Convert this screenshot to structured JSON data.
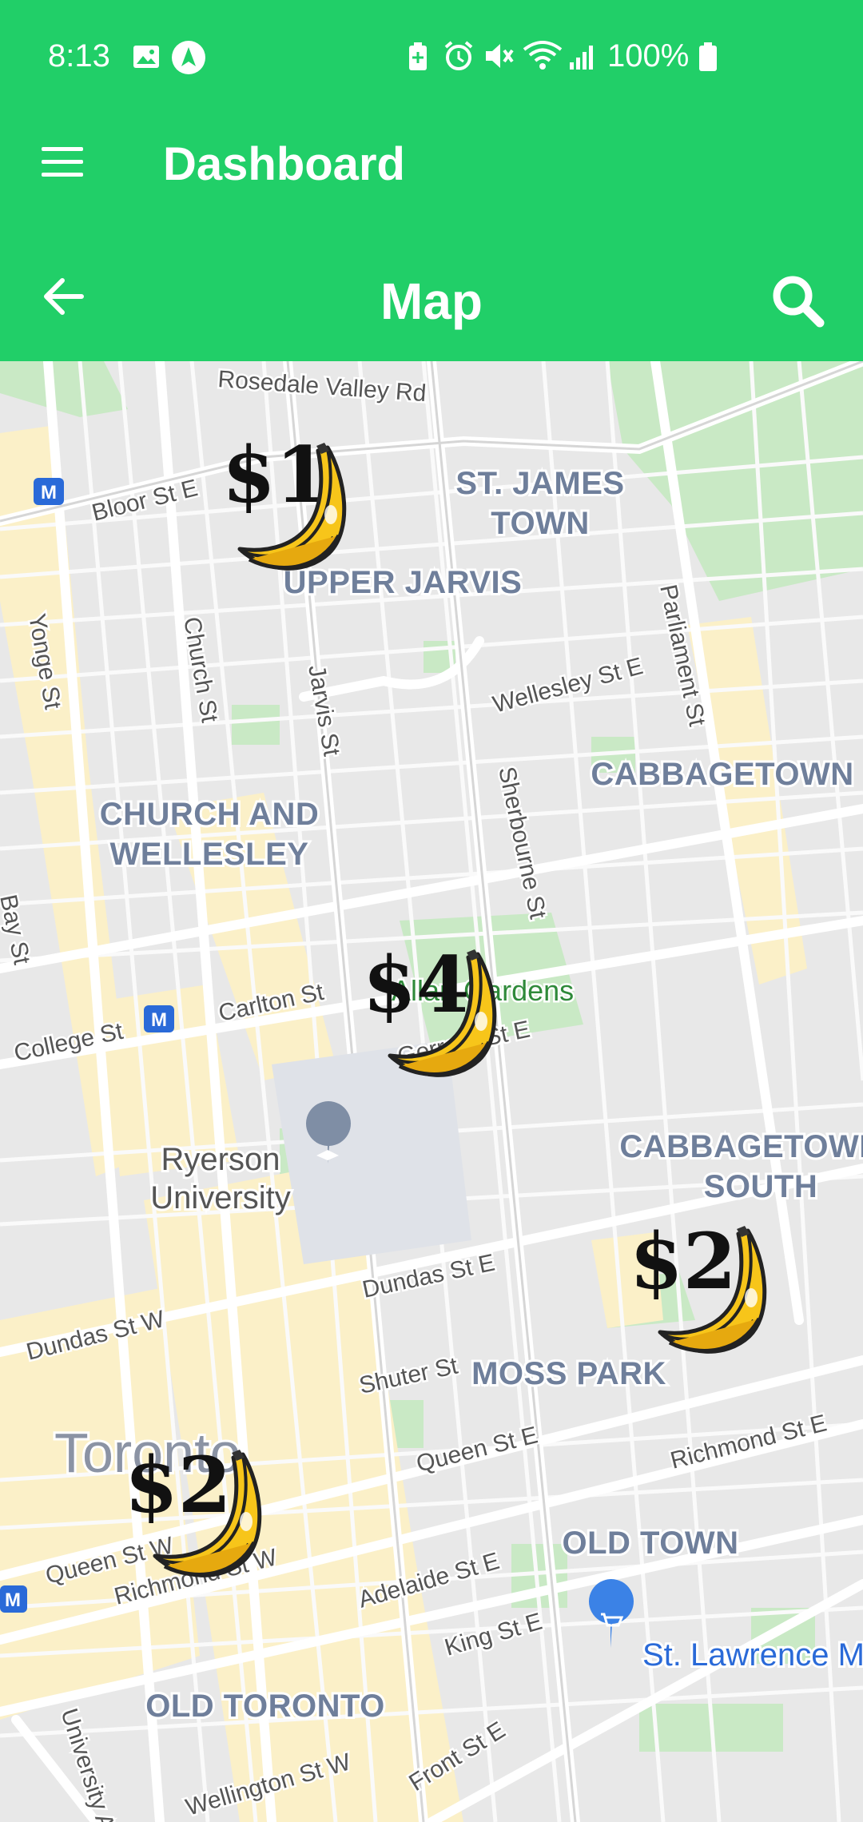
{
  "status_bar": {
    "time": "8:13",
    "battery_text": "100%",
    "icons": [
      "image-icon",
      "navigation-icon",
      "battery-saver-icon",
      "alarm-icon",
      "mute-icon",
      "wifi-icon",
      "signal-icon",
      "battery-icon"
    ]
  },
  "appbar": {
    "title": "Dashboard",
    "menu_icon": "hamburger-menu-icon"
  },
  "subbar": {
    "title": "Map",
    "back_icon": "arrow-back-icon",
    "search_icon": "search-icon"
  },
  "colors": {
    "primary": "#21cf68",
    "park": "#c9e9c5",
    "major_road": "#fdf1c4"
  },
  "map": {
    "neighbourhoods": [
      "ST. JAMES",
      "TOWN",
      "UPPER JARVIS",
      "CABBAGETOWN",
      "CHURCH AND",
      "WELLESLEY",
      "CABBAGETOWN",
      "SOUTH",
      "MOSS PARK",
      "OLD TOWN",
      "OLD TORONTO"
    ],
    "streets": [
      "Rosedale Valley Rd",
      "Bloor St E",
      "Yonge St",
      "Church St",
      "Jarvis St",
      "Wellesley St E",
      "Parliament St",
      "Sherbourne St",
      "Bay St",
      "College St",
      "Carlton St",
      "Dundas St E",
      "Dundas St W",
      "Shuter St",
      "Richmond St E",
      "Queen St E",
      "Queen St W",
      "Richmond St W",
      "Adelaide St E",
      "King St E",
      "Front St E",
      "Wellington St W",
      "University Ave",
      "Gerrard St E"
    ],
    "places": [
      "Ryerson",
      "University",
      "St. Lawrence M",
      "Allan Gardens",
      "Toronto"
    ],
    "markers": [
      {
        "price": "$1",
        "icon": "banana-icon"
      },
      {
        "price": "$4",
        "icon": "banana-icon"
      },
      {
        "price": "$2",
        "icon": "banana-icon"
      },
      {
        "price": "$2",
        "icon": "banana-icon"
      }
    ]
  }
}
